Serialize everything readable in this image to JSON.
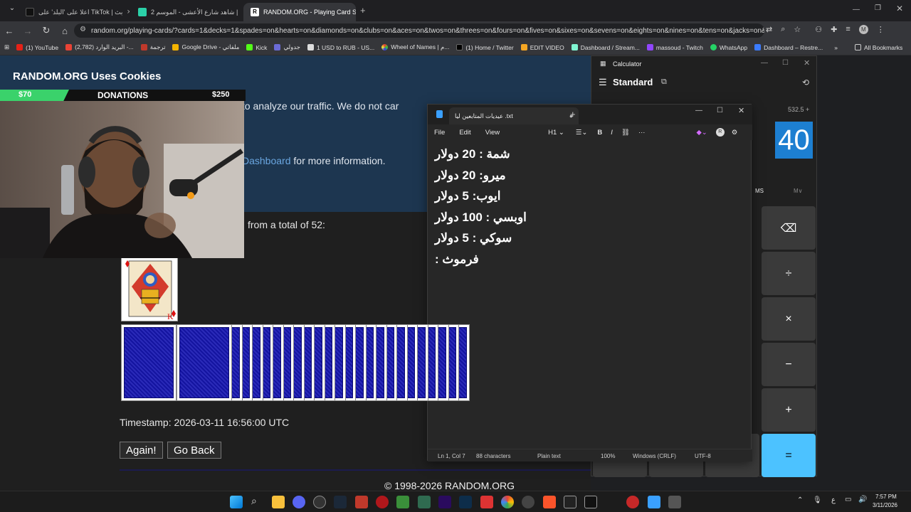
{
  "browser": {
    "tabs": [
      {
        "label": "اعلا على 'البلد' على TikTok | بث",
        "active": false
      },
      {
        "label": "شاهد شارع الأعشى - الموسم 2 |",
        "active": false
      },
      {
        "label": "RANDOM.ORG - Playing Card S",
        "active": true
      }
    ],
    "url": "random.org/playing-cards/?cards=1&decks=1&spades=on&hearts=on&diamonds=on&clubs=on&aces=on&twos=on&threes=on&fours=on&fives=on&sixes=on&sevens=on&eights=on&nines=on&tens=on&jacks=on&que...",
    "bookmarks": [
      "(1) YouTube",
      "(2,782) البريد الوارد -...",
      "ترجمة",
      "Google Drive - ملفاتي",
      "Kick",
      "جدولي",
      "1 USD to RUB - US...",
      "Wheel of Names | م...",
      "(1) Home / Twitter",
      "EDIT VIDEO",
      "Dashboard / Stream...",
      "massoud - Twitch",
      "WhatsApp",
      "Dashboard – Restre..."
    ],
    "all_bookmarks": "All Bookmarks"
  },
  "page": {
    "cookie_title": "RANDOM.ORG Uses Cookies",
    "cookie_text": "We use cookies to remember your preferences and to analyze our traffic. We do not car",
    "cookie_link": "Dashboard",
    "cookie_text2": " for more information.",
    "pick_text": "from a total of 52:",
    "timestamp": "Timestamp: 2026-03-11 16:56:00 UTC",
    "again_label": "Again!",
    "back_label": "Go Back",
    "copyright": "© 1998-2026 RANDOM.ORG"
  },
  "donations": {
    "left": "$70",
    "title": "DONATIONS",
    "right": "$250",
    "progress": 0.28
  },
  "calculator": {
    "title": "Calculator",
    "mode": "Standard",
    "expression": "532.5 +",
    "display": "40",
    "memory": [
      "MS",
      "M∨"
    ],
    "keys": [
      "⌫",
      "÷",
      "×",
      "−",
      "+",
      "="
    ]
  },
  "notepad": {
    "tab_title": "عيديات المتابعين ليا .txt",
    "menu": [
      "File",
      "Edit",
      "View"
    ],
    "heading": "H1",
    "lines": [
      "شمة : 20 دولار",
      "ميرو: 20 دولار",
      "ايوب: 5 دولار",
      "اوبسي : 100 دولار",
      "سوكي : 5 دولار",
      "فرموث :"
    ],
    "status": {
      "position": "Ln 1, Col 7",
      "chars": "88 characters",
      "format": "Plain text",
      "zoom": "100%",
      "eol": "Windows (CRLF)",
      "encoding": "UTF-8"
    }
  },
  "taskbar": {
    "time": "7:57 PM",
    "date": "3/11/2026",
    "lang": "ع"
  }
}
